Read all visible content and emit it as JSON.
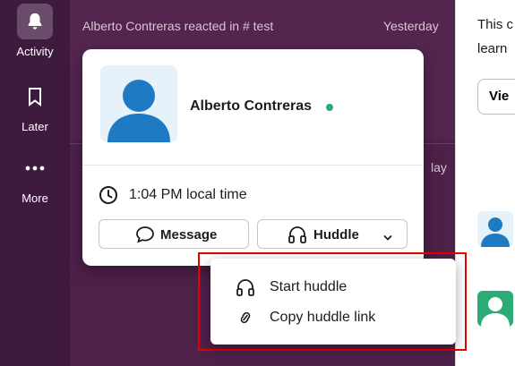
{
  "sidebar": {
    "items": [
      {
        "label": "Activity",
        "icon": "bell-icon",
        "active": true
      },
      {
        "label": "Later",
        "icon": "bookmark-icon",
        "active": false
      },
      {
        "label": "More",
        "icon": "more-icon",
        "active": false
      }
    ]
  },
  "feed": {
    "item1": {
      "text": "Alberto Contreras reacted in # test",
      "time": "Yesterday"
    },
    "item2": {
      "time_partial": "lay"
    }
  },
  "right_panel": {
    "line1": "This c",
    "line2": "learn",
    "button_label": "Vie"
  },
  "profile_card": {
    "name": "Alberto Contreras",
    "presence": "active",
    "local_time": "1:04 PM local time",
    "message_button": "Message",
    "huddle_button": "Huddle"
  },
  "huddle_menu": {
    "items": [
      {
        "label": "Start huddle",
        "icon": "headphones-icon"
      },
      {
        "label": "Copy huddle link",
        "icon": "link-icon"
      }
    ]
  },
  "colors": {
    "sidebar_bg": "#3e1a3f",
    "presence_green": "#2bac76",
    "avatar_blue": "#1f7ac4",
    "highlight_red": "#e60000"
  }
}
